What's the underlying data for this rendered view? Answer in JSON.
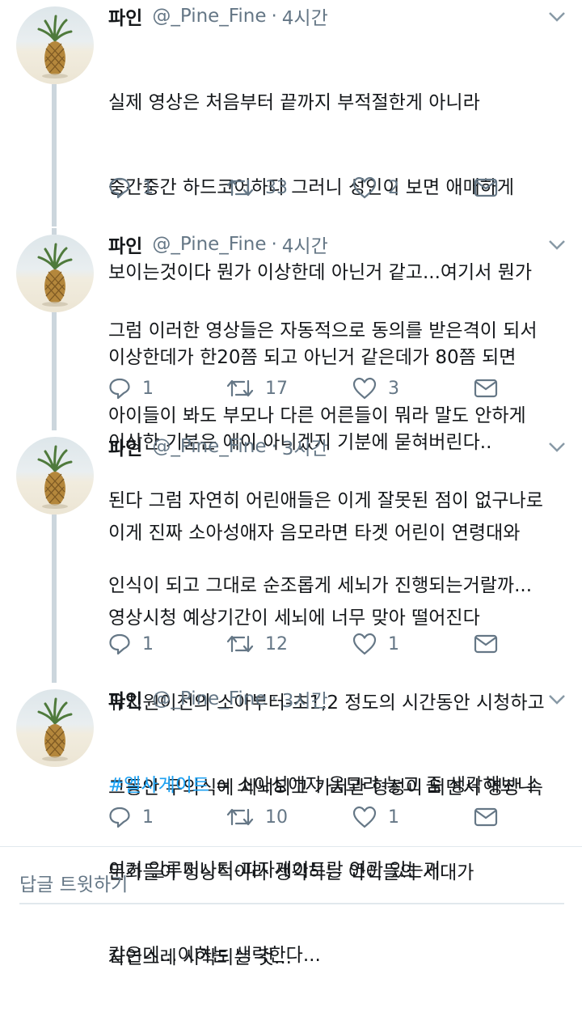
{
  "tweets": [
    {
      "name": "파인",
      "handle": "@_Pine_Fine",
      "time": "4시간",
      "lines": [
        "실제 영상은 처음부터 끝까지 부적절한게 아니라",
        "중간중간 하드코어하다 그러니 성인이 보면 애매하게",
        "보이는것이다 뭔가 이상한데 아닌거 같고...여기서 뭔가",
        "이상한데가 한20쯤 되고 아닌거 같은데가 80쯤 되면",
        "이상한 기분은 에이 아니겠지 기분에 묻혀버린다.."
      ],
      "replies": "1",
      "retweets": "33",
      "likes": "2"
    },
    {
      "name": "파인",
      "handle": "@_Pine_Fine",
      "time": "4시간",
      "lines": [
        "그럼 이러한 영상들은 자동적으로 동의를 받은격이 되서",
        "아이들이 봐도 부모나 다른 어른들이 뭐라 말도 안하게",
        "된다 그럼 자연히 어린애들은 이게 잘못된 점이 없구나로",
        "인식이 되고 그대로 순조롭게 세뇌가 진행되는거랄까..."
      ],
      "replies": "1",
      "retweets": "17",
      "likes": "3"
    },
    {
      "name": "파인",
      "handle": "@_Pine_Fine",
      "time": "3시간",
      "lines": [
        "이게 진짜 소아성애자 음모라면 타겟 어린이 연령대와",
        "영상시청 예상기간이 세뇌에 너무 맞아 떨어진다",
        "유치원이전의 소아부터-초1,2 정도의 시간동안 시청하고",
        "그동안 무의식에 세뇌되고 가치관 형성이 되면서 영상 속",
        "문화들이 정상적이라 생각하는 아이들의 세대가",
        "자연스레 시작되는 것..."
      ],
      "replies": "1",
      "retweets": "12",
      "likes": "1"
    },
    {
      "name": "파인",
      "handle": "@_Pine_Fine",
      "time": "3시간",
      "hashtag": "#엘사게이트",
      "first_line_rest": " = 소아성애자 음모라 놓고 좀 생각해보니",
      "lines": [
        "이거 일루미나티-피자게이트랑 연관 있는거",
        "같은데...이하는 생략한다..."
      ],
      "replies": "1",
      "retweets": "10",
      "likes": "1"
    }
  ],
  "reply_placeholder": "답글 트윗하기",
  "colors": {
    "accent": "#1da1f2",
    "secondary_text": "#657786",
    "thread_line": "#ccd6dd"
  }
}
